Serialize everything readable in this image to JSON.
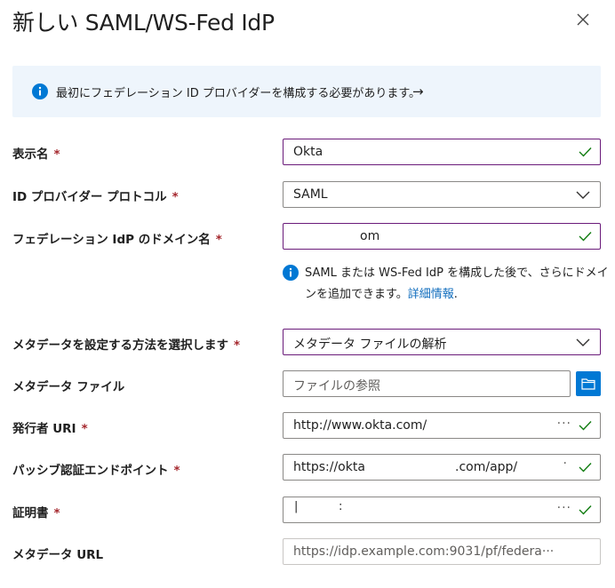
{
  "panel": {
    "title": "新しい SAML/WS-Fed IdP"
  },
  "banner": {
    "text": "最初にフェデレーション ID プロバイダーを構成する必要があります。"
  },
  "fields": {
    "display_name": {
      "label": "表示名",
      "value": "Okta"
    },
    "protocol": {
      "label": "ID プロバイダー プロトコル",
      "value": "SAML"
    },
    "domain": {
      "label": "フェデレーション IdP のドメイン名",
      "value": "om"
    },
    "metadata_method": {
      "label": "メタデータを設定する方法を選択します",
      "value": "メタデータ ファイルの解析"
    },
    "metadata_file": {
      "label": "メタデータ ファイル",
      "placeholder": "ファイルの参照"
    },
    "issuer_uri": {
      "label": "発行者 URI",
      "value": "http://www.okta.com/"
    },
    "passive_endpoint": {
      "label": "パッシブ認証エンドポイント",
      "value_prefix": "https://okta",
      "value_mid": ".com/app/"
    },
    "certificate": {
      "label": "証明書",
      "value": ""
    },
    "metadata_url": {
      "label": "メタデータ URL",
      "value": "https://idp.example.com:9031/pf/federa···"
    }
  },
  "required_marker": "*",
  "note": {
    "text": "SAML または WS-Fed IdP を構成した後で、さらにドメインを追加できます。",
    "link": "詳細情報",
    "tail": "."
  },
  "ellipsis": "···",
  "colors": {
    "accent": "#0078d4",
    "focus_border": "#6a1b7a",
    "check": "#107c10",
    "required": "#a4262c",
    "banner_bg": "#eef5fc",
    "link": "#0f6cbd"
  }
}
